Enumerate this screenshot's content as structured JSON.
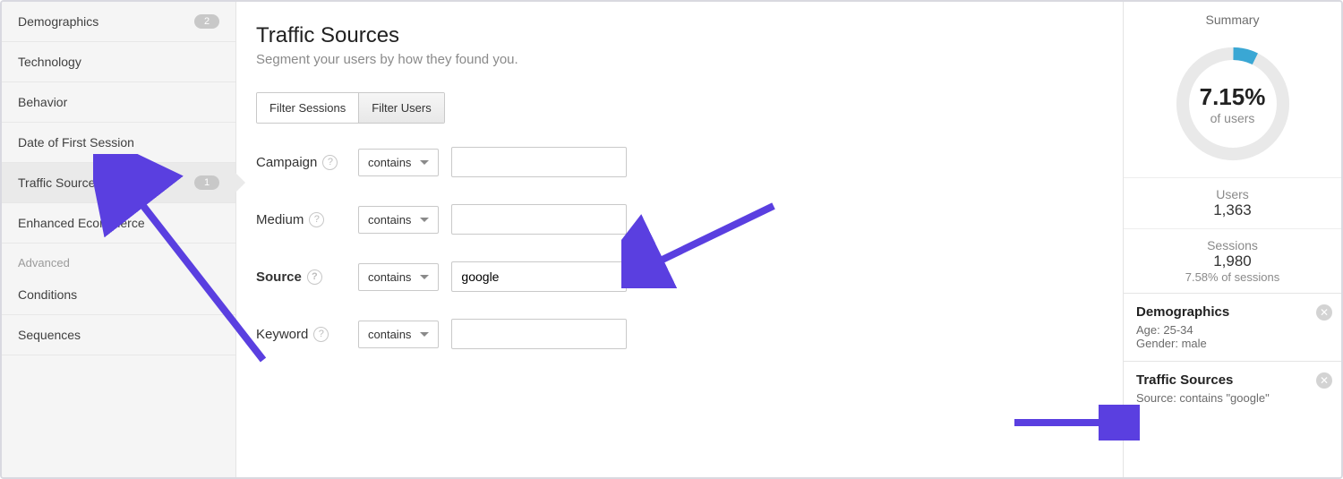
{
  "sidebar": {
    "items": [
      {
        "label": "Demographics",
        "badge": "2"
      },
      {
        "label": "Technology"
      },
      {
        "label": "Behavior"
      },
      {
        "label": "Date of First Session"
      },
      {
        "label": "Traffic Sources",
        "badge": "1",
        "selected": true
      },
      {
        "label": "Enhanced Ecommerce"
      }
    ],
    "advanced_label": "Advanced",
    "advanced": [
      {
        "label": "Conditions"
      },
      {
        "label": "Sequences"
      }
    ]
  },
  "main": {
    "title": "Traffic Sources",
    "subtitle": "Segment your users by how they found you.",
    "filter_sessions_label": "Filter Sessions",
    "filter_users_label": "Filter Users",
    "rows": {
      "campaign": {
        "label": "Campaign",
        "op": "contains",
        "value": ""
      },
      "medium": {
        "label": "Medium",
        "op": "contains",
        "value": ""
      },
      "source": {
        "label": "Source",
        "op": "contains",
        "value": "google"
      },
      "keyword": {
        "label": "Keyword",
        "op": "contains",
        "value": ""
      }
    }
  },
  "summary": {
    "title": "Summary",
    "donut_percent": "7.15%",
    "donut_label": "of users",
    "users_label": "Users",
    "users_value": "1,363",
    "sessions_label": "Sessions",
    "sessions_value": "1,980",
    "sessions_percent": "7.58% of sessions",
    "applied": [
      {
        "title": "Demographics",
        "lines": [
          "Age: 25-34",
          "Gender: male"
        ]
      },
      {
        "title": "Traffic Sources",
        "lines": [
          "Source: contains \"google\""
        ]
      }
    ]
  }
}
